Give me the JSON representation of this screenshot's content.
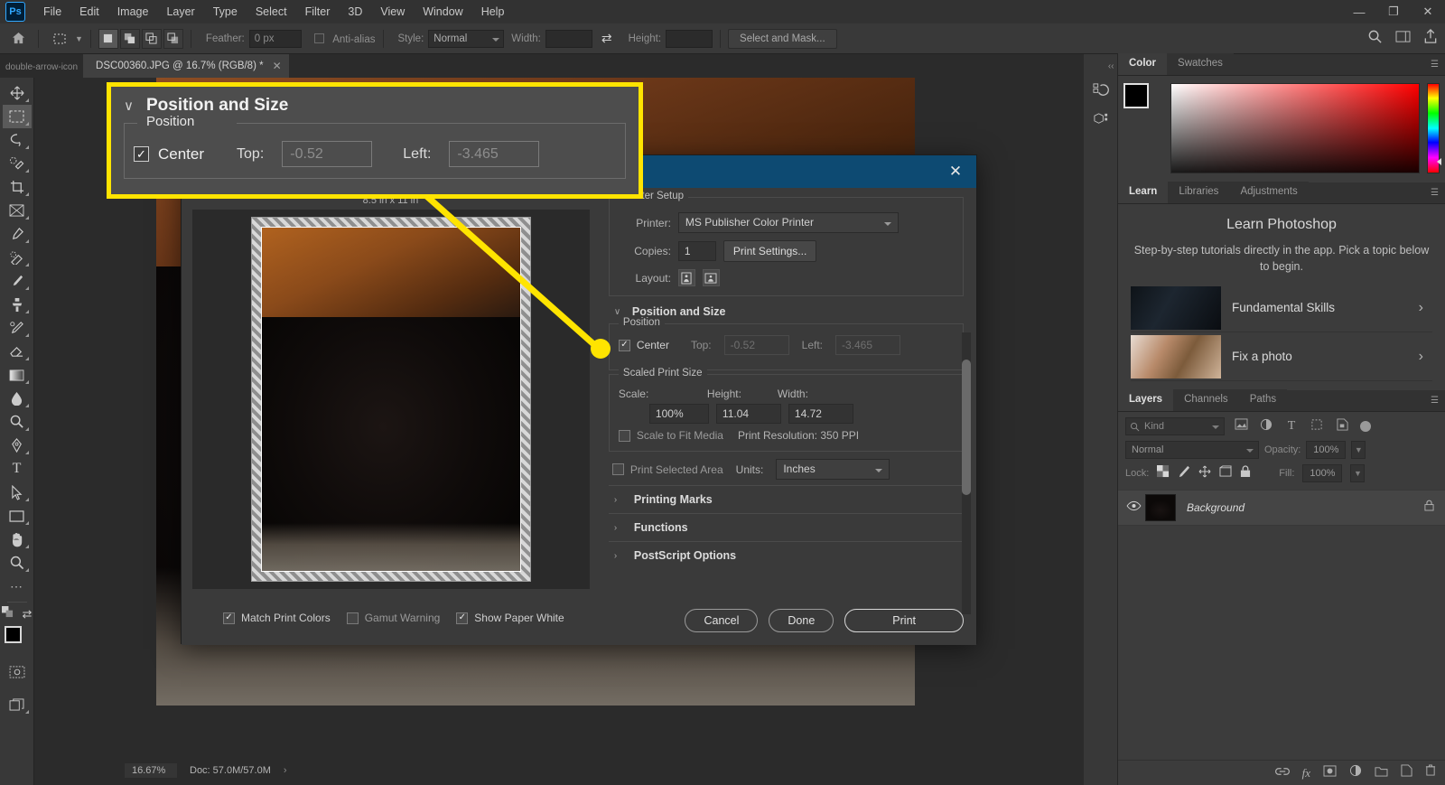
{
  "menubar": {
    "logo": "Ps",
    "items": [
      "File",
      "Edit",
      "Image",
      "Layer",
      "Type",
      "Select",
      "Filter",
      "3D",
      "View",
      "Window",
      "Help"
    ],
    "window_controls": {
      "minimize": "—",
      "restore": "❐",
      "close": "✕"
    }
  },
  "optionsbar": {
    "home_icon": "home-icon",
    "tool_icon": "rectangular-marquee-icon",
    "feather_label": "Feather:",
    "feather_value": "0 px",
    "antialias_label": "Anti-alias",
    "style_label": "Style:",
    "style_value": "Normal",
    "width_label": "Width:",
    "width_value": "",
    "swap_icon": "swap-arrows-icon",
    "height_label": "Height:",
    "height_value": "",
    "select_and_mask": "Select and Mask...",
    "right_icons": [
      "search-icon",
      "workspace-icon",
      "share-icon"
    ]
  },
  "tabbar": {
    "expand_icon": "double-arrow-icon",
    "doc_title": "DSC00360.JPG @ 16.7% (RGB/8) *",
    "close_label": "✕"
  },
  "toolbar": {
    "tools": [
      {
        "name": "move-tool",
        "glyph": "✥"
      },
      {
        "name": "rectangular-marquee-tool",
        "glyph": "⬚",
        "active": true
      },
      {
        "name": "lasso-tool",
        "glyph": "⬭"
      },
      {
        "name": "quick-selection-tool",
        "glyph": "✐"
      },
      {
        "name": "crop-tool",
        "glyph": "⌦"
      },
      {
        "name": "frame-tool",
        "glyph": "⌧"
      },
      {
        "name": "eyedropper-tool",
        "glyph": "⚗"
      },
      {
        "name": "spot-healing-brush-tool",
        "glyph": "✒"
      },
      {
        "name": "brush-tool",
        "glyph": "✎"
      },
      {
        "name": "clone-stamp-tool",
        "glyph": "⚓"
      },
      {
        "name": "history-brush-tool",
        "glyph": "✐"
      },
      {
        "name": "eraser-tool",
        "glyph": "◨"
      },
      {
        "name": "gradient-tool",
        "glyph": "▣"
      },
      {
        "name": "blur-tool",
        "glyph": "●"
      },
      {
        "name": "dodge-tool",
        "glyph": "⚲"
      },
      {
        "name": "pen-tool",
        "glyph": "✒"
      },
      {
        "name": "type-tool",
        "glyph": "T"
      },
      {
        "name": "path-selection-tool",
        "glyph": "➤"
      },
      {
        "name": "rectangle-tool",
        "glyph": "▭"
      },
      {
        "name": "hand-tool",
        "glyph": "✋"
      },
      {
        "name": "zoom-tool",
        "glyph": "⚲"
      },
      {
        "name": "edit-toolbar-tool",
        "glyph": "⋯"
      }
    ],
    "swap_colors_icon": "swap-colors-icon",
    "default_colors_icon": "default-colors-icon",
    "quickmask_icon": "quick-mask-icon",
    "screenmode_icon": "screen-mode-icon",
    "foreground_color": "#000000",
    "background_color": "#c8c8c8"
  },
  "statusbar": {
    "zoom": "16.67%",
    "doc": "Doc: 57.0M/57.0M",
    "arrow": "›"
  },
  "print_dialog": {
    "close_label": "✕",
    "paper_size_label": "8.5 in x 11 in",
    "printer_setup": {
      "legend": "Printer Setup",
      "printer_label": "Printer:",
      "printer_value": "MS Publisher Color Printer",
      "copies_label": "Copies:",
      "copies_value": "1",
      "print_settings_button": "Print Settings...",
      "layout_label": "Layout:",
      "layout_portrait_icon": "portrait-layout-icon",
      "layout_landscape_icon": "landscape-layout-icon"
    },
    "position_and_size": {
      "title": "Position and Size",
      "chevron": "∨",
      "position_legend": "Position",
      "center_label": "Center",
      "center_checked": true,
      "top_label": "Top:",
      "top_value": "-0.52",
      "left_label": "Left:",
      "left_value": "-3.465",
      "scaled_legend": "Scaled Print Size",
      "scale_label": "Scale:",
      "scale_value": "100%",
      "height_label": "Height:",
      "height_value": "11.04",
      "width_label": "Width:",
      "width_value": "14.72",
      "scale_to_fit_label": "Scale to Fit Media",
      "scale_to_fit_checked": false,
      "print_resolution": "Print Resolution: 350 PPI",
      "print_selected_area_label": "Print Selected Area",
      "print_selected_area_checked": false,
      "units_label": "Units:",
      "units_value": "Inches"
    },
    "collapsed_sections": [
      {
        "chevron": "›",
        "label": "Printing Marks"
      },
      {
        "chevron": "›",
        "label": "Functions"
      },
      {
        "chevron": "›",
        "label": "PostScript Options"
      }
    ],
    "footer_checks": [
      {
        "label": "Match Print Colors",
        "checked": true
      },
      {
        "label": "Gamut Warning",
        "checked": false
      },
      {
        "label": "Show Paper White",
        "checked": true
      }
    ],
    "buttons": {
      "cancel": "Cancel",
      "done": "Done",
      "print": "Print"
    }
  },
  "callout": {
    "title": "Position and Size",
    "chevron": "∨",
    "position_legend": "Position",
    "center_label": "Center",
    "center_checked": true,
    "top_label": "Top:",
    "top_value": "-0.52",
    "left_label": "Left:",
    "left_value": "-3.465",
    "highlight_color": "#ffe400"
  },
  "right_dock": {
    "rail_icons": [
      "collapse-icon",
      "history-icon",
      "3d-icon"
    ],
    "color_panel": {
      "tabs": [
        {
          "label": "Color",
          "active": true
        },
        {
          "label": "Swatches",
          "active": false
        }
      ],
      "menu_icon": "panel-menu-icon",
      "foreground_color": "#000000",
      "background_color": "#d0d0d0"
    },
    "learn_panel": {
      "tabs": [
        {
          "label": "Learn",
          "active": true
        },
        {
          "label": "Libraries",
          "active": false
        },
        {
          "label": "Adjustments",
          "active": false
        }
      ],
      "menu_icon": "panel-menu-icon",
      "title": "Learn Photoshop",
      "subtitle": "Step-by-step tutorials directly in the app. Pick a topic below to begin.",
      "cards": [
        {
          "label": "Fundamental Skills",
          "chevron": "›"
        },
        {
          "label": "Fix a photo",
          "chevron": "›"
        }
      ]
    },
    "layers_panel": {
      "tabs": [
        {
          "label": "Layers",
          "active": true
        },
        {
          "label": "Channels",
          "active": false
        },
        {
          "label": "Paths",
          "active": false
        }
      ],
      "menu_icon": "panel-menu-icon",
      "kind_label": "Kind",
      "filter_icons": [
        "pixel-filter-icon",
        "adjustment-filter-icon",
        "type-filter-icon",
        "shape-filter-icon",
        "smart-object-filter-icon"
      ],
      "filter_toggle_icon": "filter-toggle-icon",
      "blend_mode": "Normal",
      "opacity_label": "Opacity:",
      "opacity_value": "100%",
      "lock_label": "Lock:",
      "lock_icons": [
        "lock-transparency-icon",
        "lock-image-icon",
        "lock-position-icon",
        "lock-artboard-icon",
        "lock-all-icon"
      ],
      "fill_label": "Fill:",
      "fill_value": "100%",
      "layers": [
        {
          "name": "Background",
          "visible": true,
          "locked": true,
          "eye_icon": "eye-icon",
          "lock_icon": "lock-icon"
        }
      ],
      "footer_icons": [
        "link-icon",
        "fx-icon",
        "mask-icon",
        "adjustment-icon",
        "group-icon",
        "new-layer-icon",
        "delete-icon"
      ],
      "footer_labels": [
        "∞",
        "fx",
        "▣",
        "◑",
        "❐",
        "⊞",
        "Ὕ1"
      ]
    }
  }
}
